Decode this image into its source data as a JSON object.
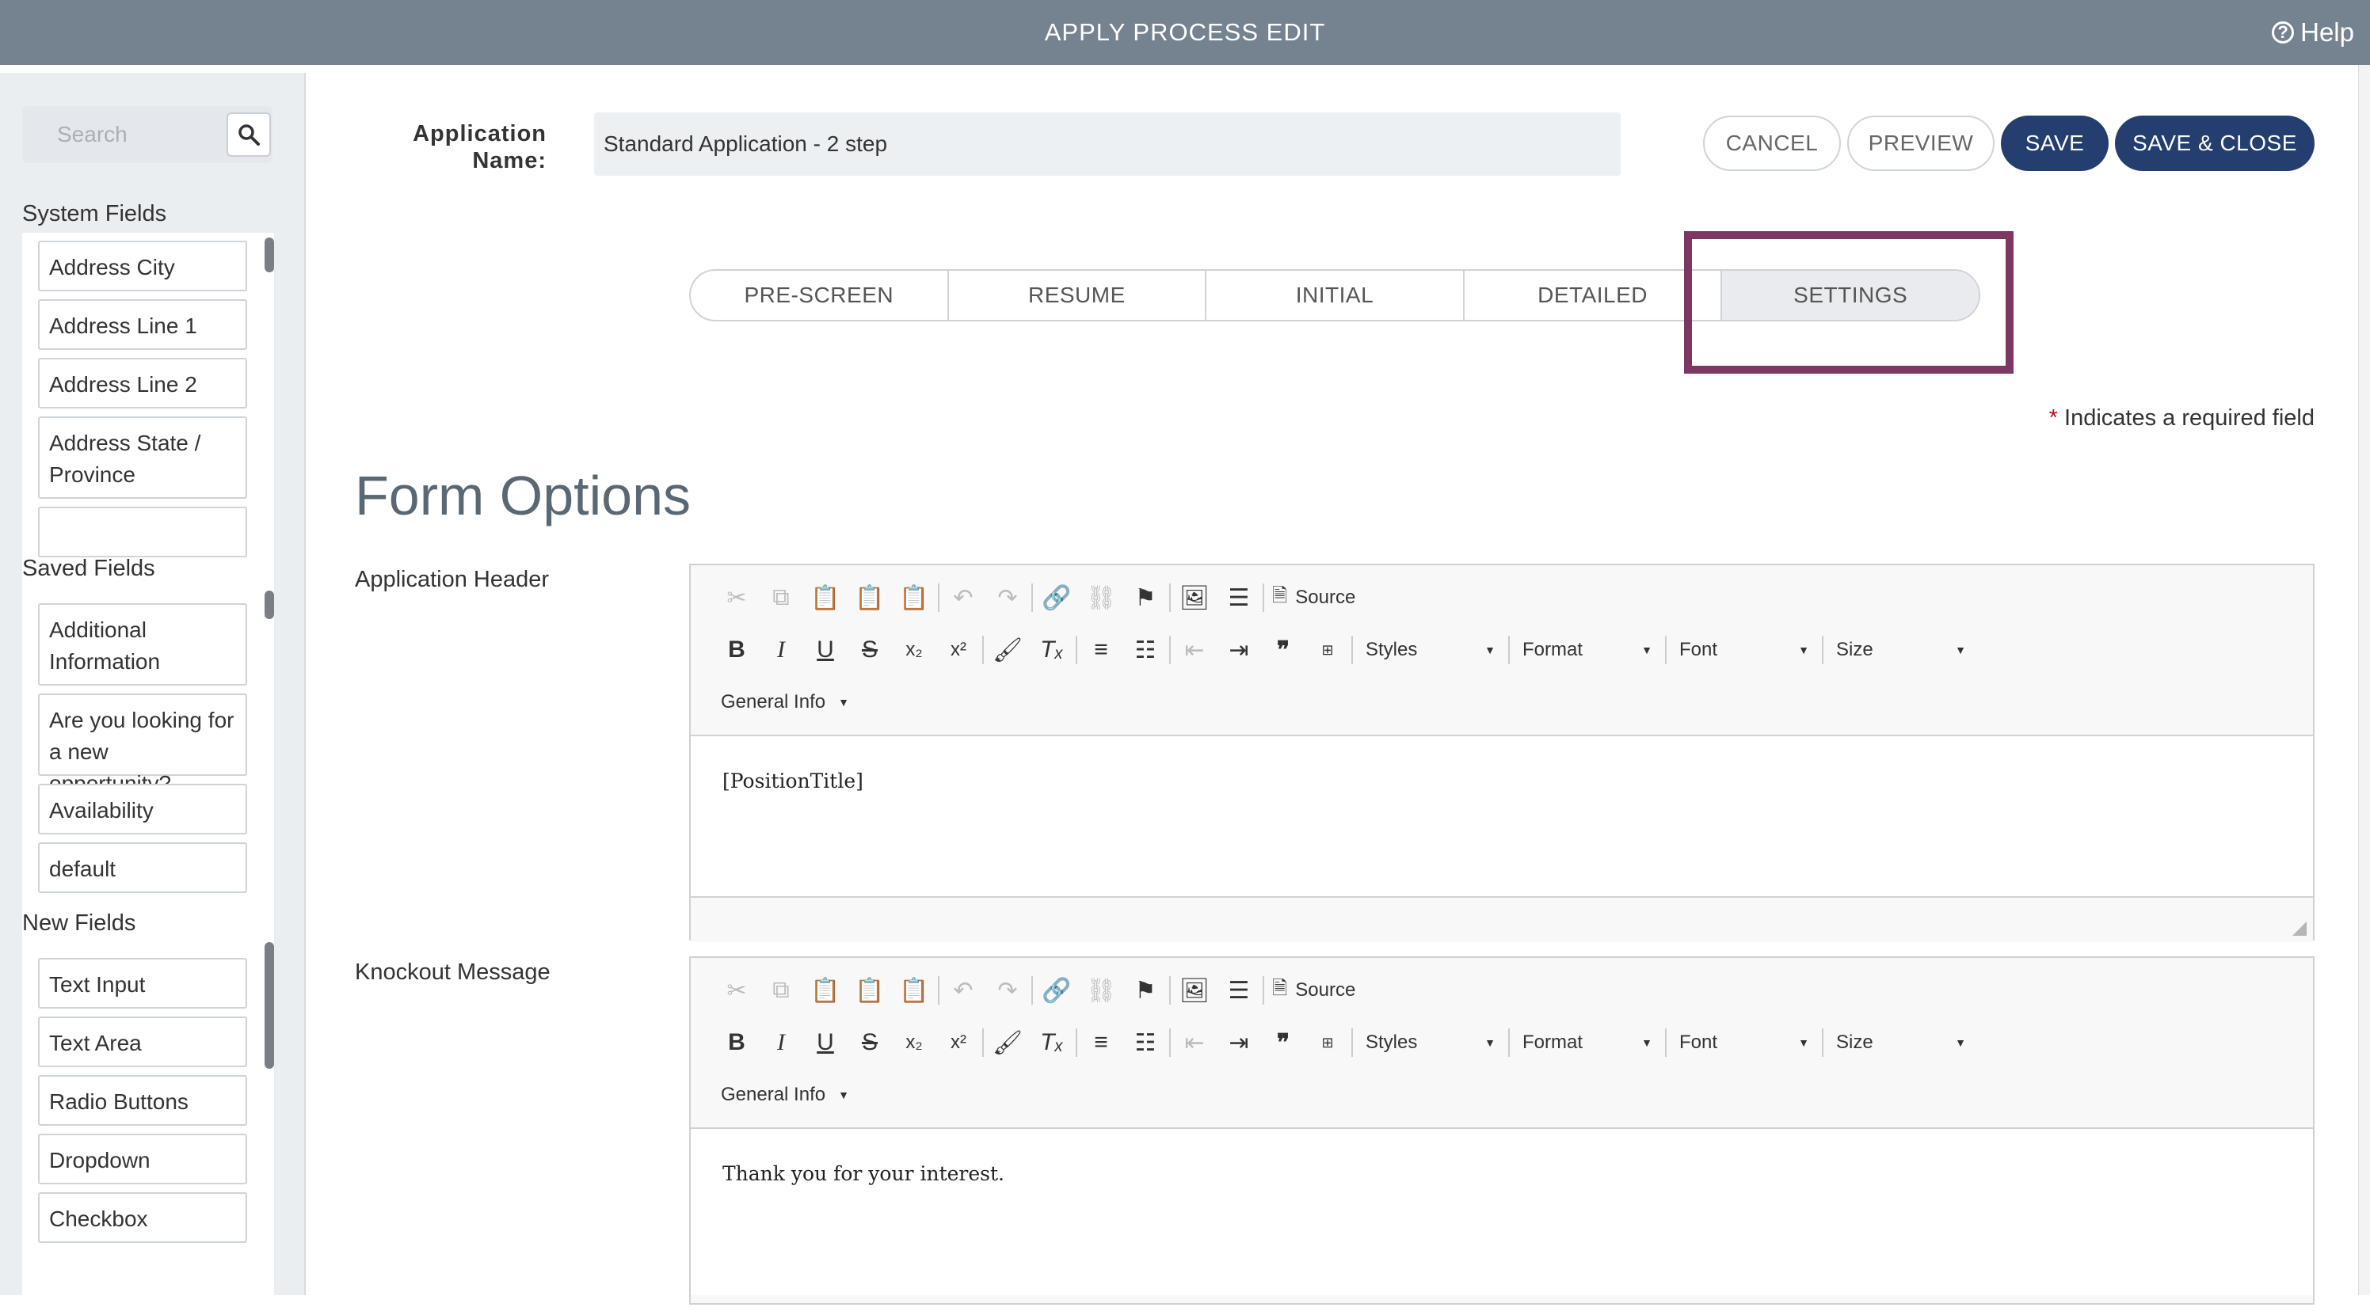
{
  "header": {
    "title": "APPLY PROCESS EDIT",
    "help_label": "Help",
    "help_icon_glyph": "?"
  },
  "sidebar": {
    "search_placeholder": "Search",
    "system_fields": {
      "label": "System Fields",
      "items": [
        "Address City",
        "Address Line 1",
        "Address Line 2",
        "Address State / Province"
      ]
    },
    "saved_fields": {
      "label": "Saved Fields",
      "items": [
        "Additional Information",
        "Are you looking for a new opportunity?",
        "Availability",
        "default"
      ]
    },
    "new_fields": {
      "label": "New Fields",
      "items": [
        "Text Input",
        "Text Area",
        "Radio Buttons",
        "Dropdown",
        "Checkbox"
      ]
    }
  },
  "form": {
    "app_name_label_line1": "Application",
    "app_name_label_line2": "Name:",
    "app_name_value": "Standard Application - 2 step"
  },
  "actions": {
    "cancel": "CANCEL",
    "preview": "PREVIEW",
    "save": "SAVE",
    "save_close": "SAVE & CLOSE"
  },
  "tabs": [
    "PRE-SCREEN",
    "RESUME",
    "INITIAL",
    "DETAILED",
    "SETTINGS"
  ],
  "active_tab": "SETTINGS",
  "required_note": {
    "star": "*",
    "text": "Indicates a required field"
  },
  "form_options": {
    "title": "Form Options",
    "toolbar": {
      "source_label": "Source",
      "styles": "Styles",
      "format": "Format",
      "font": "Font",
      "size": "Size",
      "general_info": "General Info"
    },
    "app_header": {
      "label": "Application Header",
      "content": "[PositionTitle]"
    },
    "knockout": {
      "label": "Knockout Message",
      "content": "Thank you for your interest."
    }
  },
  "colors": {
    "topbar": "#758390",
    "primary_button": "#233e6f",
    "highlight": "#7c3763",
    "required": "#d0021b"
  }
}
